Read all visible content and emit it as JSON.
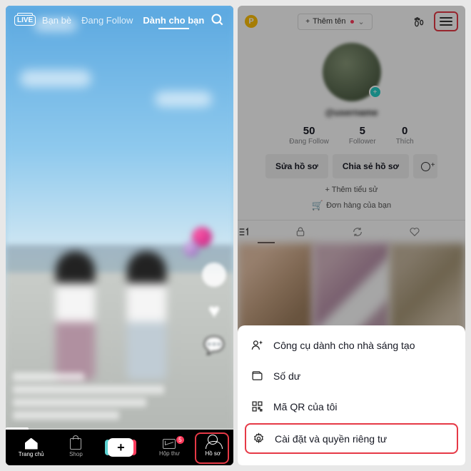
{
  "left": {
    "tabs": {
      "friends": "Bạn bè",
      "following": "Đang Follow",
      "foryou": "Dành cho bạn"
    },
    "nav": {
      "home": "Trang chủ",
      "shop": "Shop",
      "inbox": "Hộp thư",
      "profile": "Hồ sơ",
      "inbox_badge": "5"
    }
  },
  "right": {
    "header": {
      "add_name": "Thêm tên",
      "chev": "⌄"
    },
    "username": "@username",
    "stats": {
      "following_num": "50",
      "following_label": "Đang Follow",
      "followers_num": "5",
      "followers_label": "Follower",
      "likes_num": "0",
      "likes_label": "Thích"
    },
    "actions": {
      "edit": "Sửa hồ sơ",
      "share": "Chia sẻ hồ sơ"
    },
    "add_bio_prefix": "+ ",
    "add_bio": "Thêm tiểu sử",
    "orders": "Đơn hàng của bạn",
    "menu": {
      "creator": "Công cụ dành cho nhà sáng tạo",
      "balance": "Số dư",
      "qr": "Mã QR của tôi",
      "settings": "Cài đặt và quyền riêng tư"
    }
  }
}
